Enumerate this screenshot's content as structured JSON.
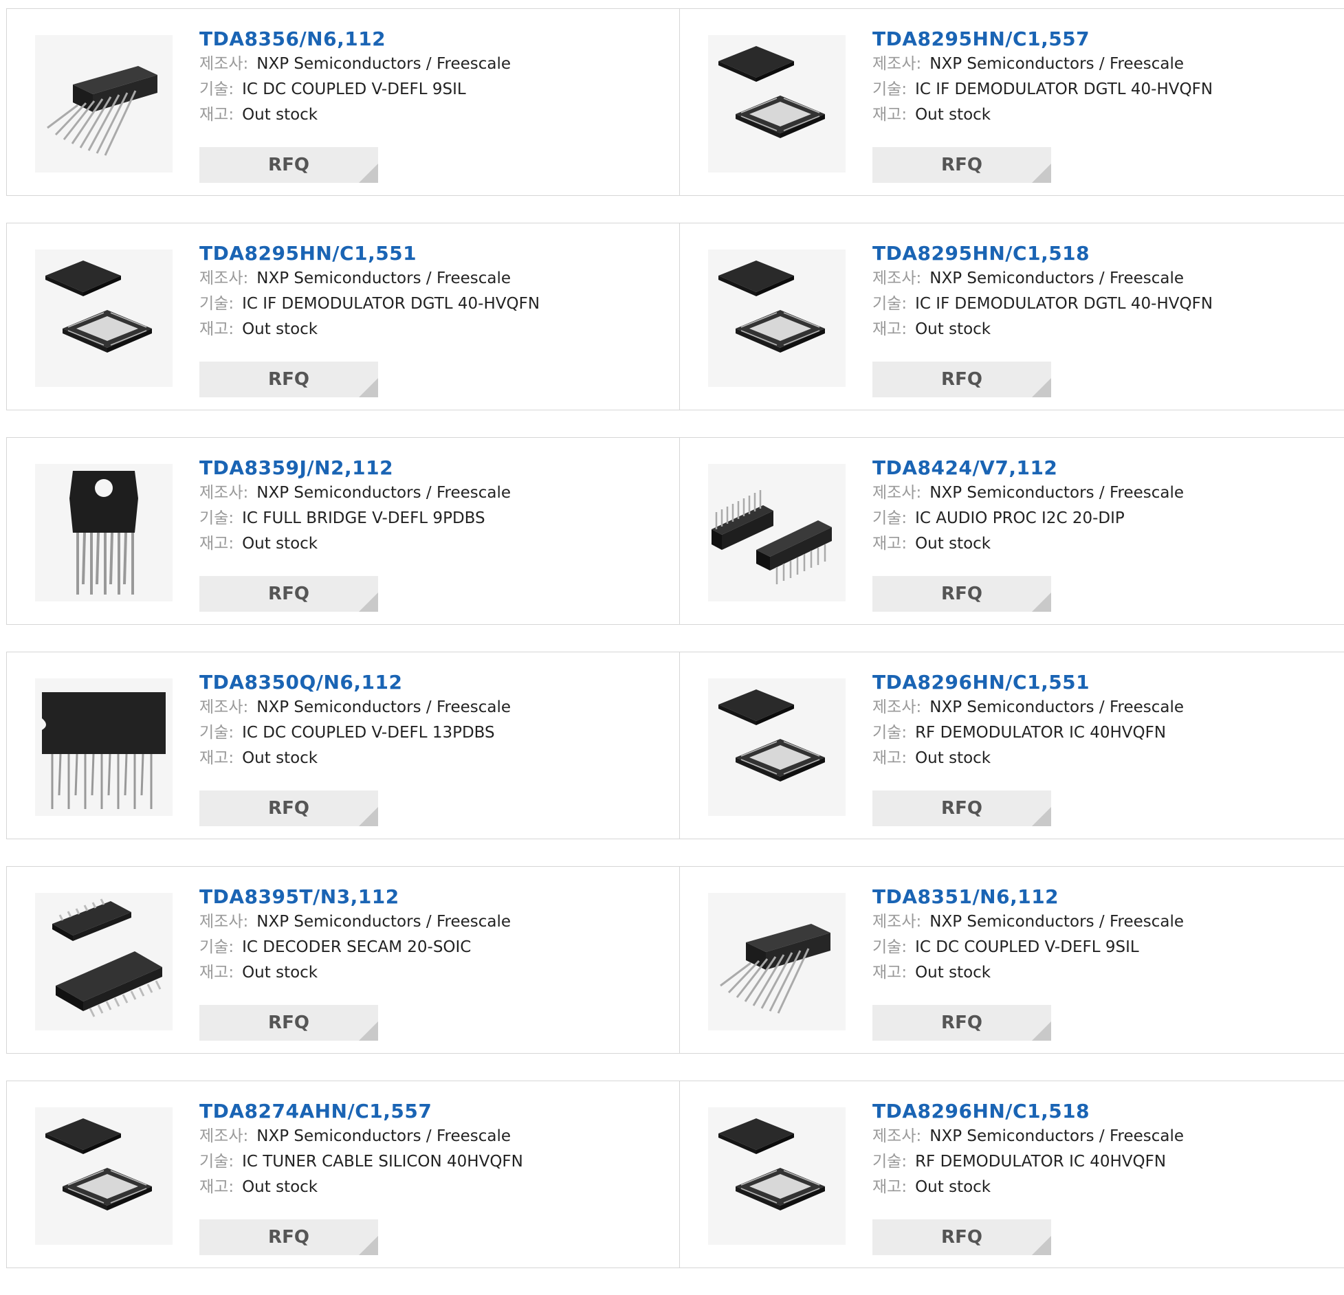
{
  "labels": {
    "manufacturer": "제조사:",
    "description": "기술:",
    "stock": "재고:"
  },
  "rfq_label": "RFQ",
  "products": [
    {
      "part": "TDA8356/N6,112",
      "manufacturer": "NXP Semiconductors / Freescale",
      "description": "IC DC COUPLED V-DEFL 9SIL",
      "stock": "Out stock",
      "package_icon": "sil-package-icon"
    },
    {
      "part": "TDA8295HN/C1,557",
      "manufacturer": "NXP Semiconductors / Freescale",
      "description": "IC IF DEMODULATOR DGTL 40-HVQFN",
      "stock": "Out stock",
      "package_icon": "qfn-package-icon"
    },
    {
      "part": "TDA8295HN/C1,551",
      "manufacturer": "NXP Semiconductors / Freescale",
      "description": "IC IF DEMODULATOR DGTL 40-HVQFN",
      "stock": "Out stock",
      "package_icon": "qfn-package-icon"
    },
    {
      "part": "TDA8295HN/C1,518",
      "manufacturer": "NXP Semiconductors / Freescale",
      "description": "IC IF DEMODULATOR DGTL 40-HVQFN",
      "stock": "Out stock",
      "package_icon": "qfn-package-icon"
    },
    {
      "part": "TDA8359J/N2,112",
      "manufacturer": "NXP Semiconductors / Freescale",
      "description": "IC FULL BRIDGE V-DEFL 9PDBS",
      "stock": "Out stock",
      "package_icon": "dbs-package-icon"
    },
    {
      "part": "TDA8424/V7,112",
      "manufacturer": "NXP Semiconductors / Freescale",
      "description": "IC AUDIO PROC I2C 20-DIP",
      "stock": "Out stock",
      "package_icon": "dip-package-icon"
    },
    {
      "part": "TDA8350Q/N6,112",
      "manufacturer": "NXP Semiconductors / Freescale",
      "description": "IC DC COUPLED V-DEFL 13PDBS",
      "stock": "Out stock",
      "package_icon": "dbs13-package-icon"
    },
    {
      "part": "TDA8296HN/C1,551",
      "manufacturer": "NXP Semiconductors / Freescale",
      "description": "RF DEMODULATOR IC 40HVQFN",
      "stock": "Out stock",
      "package_icon": "qfn-package-icon"
    },
    {
      "part": "TDA8395T/N3,112",
      "manufacturer": "NXP Semiconductors / Freescale",
      "description": "IC DECODER SECAM 20-SOIC",
      "stock": "Out stock",
      "package_icon": "soic-package-icon"
    },
    {
      "part": "TDA8351/N6,112",
      "manufacturer": "NXP Semiconductors / Freescale",
      "description": "IC DC COUPLED V-DEFL 9SIL",
      "stock": "Out stock",
      "package_icon": "sil-package-icon"
    },
    {
      "part": "TDA8274AHN/C1,557",
      "manufacturer": "NXP Semiconductors / Freescale",
      "description": "IC TUNER CABLE SILICON 40HVQFN",
      "stock": "Out stock",
      "package_icon": "qfn-package-icon"
    },
    {
      "part": "TDA8296HN/C1,518",
      "manufacturer": "NXP Semiconductors / Freescale",
      "description": "RF DEMODULATOR IC 40HVQFN",
      "stock": "Out stock",
      "package_icon": "qfn-package-icon"
    }
  ],
  "colors": {
    "link": "#1a64b4",
    "label": "#999999",
    "button_bg": "#ececec",
    "border": "#d6d6d6"
  }
}
